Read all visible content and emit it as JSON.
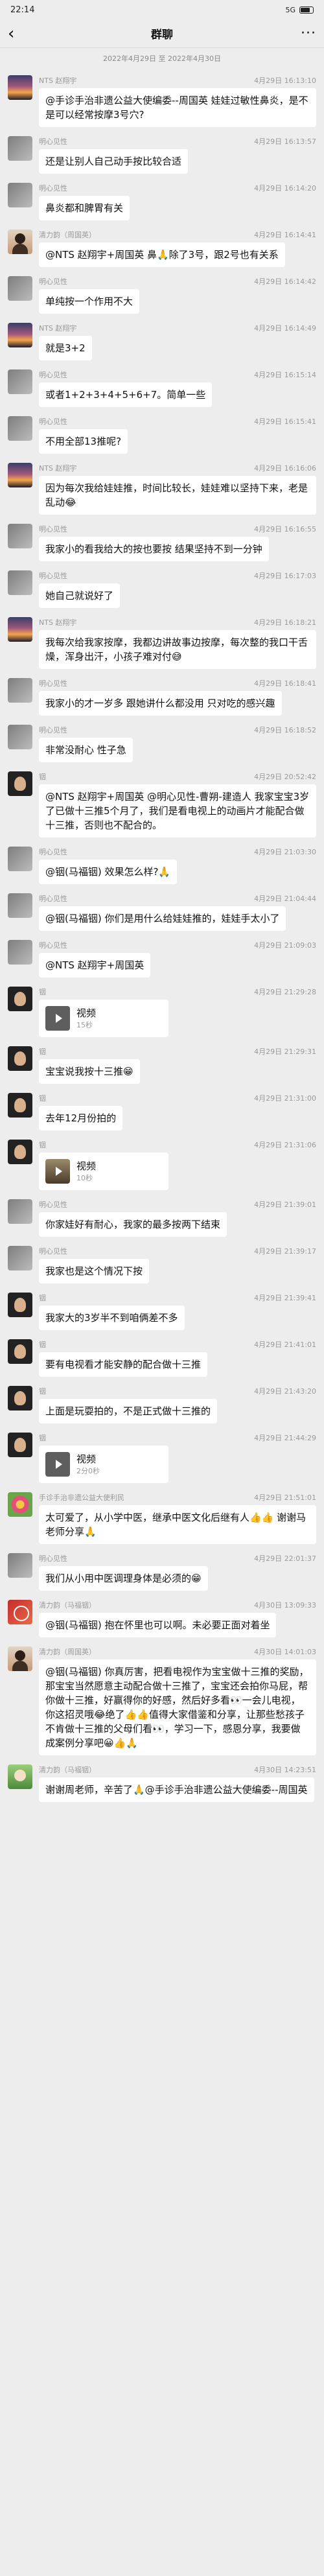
{
  "status": {
    "time": "22:14",
    "signal": "5G"
  },
  "nav": {
    "back": "‹",
    "title": "群聊",
    "more": "···"
  },
  "date_range": "2022年4月29日 至 2022年4月30日",
  "messages": [
    {
      "name": "NTS 赵翔宇",
      "time": "4月29日 16:13:10",
      "text": "@手诊手治非遗公益大使编委--周国英 娃娃过敏性鼻炎，是不是可以经常按摩3号穴?",
      "avatar": "sunset"
    },
    {
      "name": "明心见性",
      "time": "4月29日 16:13:57",
      "text": "还是让别人自己动手按比较合适",
      "avatar": "grey"
    },
    {
      "name": "明心见性",
      "time": "4月29日 16:14:20",
      "text": "鼻炎都和脾胃有关",
      "avatar": "grey"
    },
    {
      "name": "清力韵（周国英）",
      "time": "4月29日 16:14:41",
      "text": "@NTS 赵翔宇+周国英 鼻🙏除了3号，跟2号也有关系",
      "avatar": "person"
    },
    {
      "name": "明心见性",
      "time": "4月29日 16:14:42",
      "text": "单纯按一个作用不大",
      "avatar": "grey"
    },
    {
      "name": "NTS 赵翔宇",
      "time": "4月29日 16:14:49",
      "text": "就是3+2",
      "avatar": "sunset"
    },
    {
      "name": "明心见性",
      "time": "4月29日 16:15:14",
      "text": "或者1+2+3+4+5+6+7。简单一些",
      "avatar": "grey"
    },
    {
      "name": "明心见性",
      "time": "4月29日 16:15:41",
      "text": "不用全部13推呢?",
      "avatar": "grey"
    },
    {
      "name": "NTS 赵翔宇",
      "time": "4月29日 16:16:06",
      "text": "因为每次我给娃娃推，时间比较长，娃娃难以坚持下来，老是乱动😂",
      "avatar": "sunset"
    },
    {
      "name": "明心见性",
      "time": "4月29日 16:16:55",
      "text": "我家小的看我给大的按也要按 结果坚持不到一分钟",
      "avatar": "grey"
    },
    {
      "name": "明心见性",
      "time": "4月29日 16:17:03",
      "text": "她自己就说好了",
      "avatar": "grey"
    },
    {
      "name": "NTS 赵翔宇",
      "time": "4月29日 16:18:21",
      "text": "我每次给我家按摩，我都边讲故事边按摩，每次整的我口干舌燥，浑身出汗，小孩子难对付😅",
      "avatar": "sunset"
    },
    {
      "name": "明心见性",
      "time": "4月29日 16:18:41",
      "text": "我家小的才一岁多 跟她讲什么都没用 只对吃的感兴趣",
      "avatar": "grey"
    },
    {
      "name": "明心见性",
      "time": "4月29日 16:18:52",
      "text": "非常没耐心 性子急",
      "avatar": "grey"
    },
    {
      "name": "铟",
      "time": "4月29日 20:52:42",
      "text": "@NTS 赵翔宇+周国英 @明心见性-曹朔-建造人 我家宝宝3岁了已做十三推5个月了，我们是看电视上的动画片才能配合做十三推，否则也不配合的。",
      "avatar": "dark"
    },
    {
      "name": "明心见性",
      "time": "4月29日 21:03:30",
      "text": "@铟(马福铟) 效果怎么样?🙏",
      "avatar": "grey"
    },
    {
      "name": "明心见性",
      "time": "4月29日 21:04:44",
      "text": "@铟(马福铟) 你们是用什么给娃娃推的，娃娃手太小了",
      "avatar": "grey"
    },
    {
      "name": "明心见性",
      "time": "4月29日 21:09:03",
      "text": "@NTS 赵翔宇+周国英",
      "avatar": "grey"
    },
    {
      "name": "铟",
      "time": "4月29日 21:29:28",
      "video": {
        "title": "视频",
        "duration": "15秒"
      },
      "avatar": "dark"
    },
    {
      "name": "铟",
      "time": "4月29日 21:29:31",
      "text": "宝宝说我按十三推😁",
      "avatar": "dark"
    },
    {
      "name": "铟",
      "time": "4月29日 21:31:00",
      "text": "去年12月份拍的",
      "avatar": "dark"
    },
    {
      "name": "铟",
      "time": "4月29日 21:31:06",
      "video": {
        "title": "视频",
        "duration": "10秒"
      },
      "avatar": "dark",
      "photo": true
    },
    {
      "name": "明心见性",
      "time": "4月29日 21:39:01",
      "text": "你家娃好有耐心，我家的最多按两下结束",
      "avatar": "grey"
    },
    {
      "name": "明心见性",
      "time": "4月29日 21:39:17",
      "text": "我家也是这个情况下按",
      "avatar": "grey"
    },
    {
      "name": "铟",
      "time": "4月29日 21:39:41",
      "text": "我家大的3岁半不到咱俩差不多",
      "avatar": "dark"
    },
    {
      "name": "铟",
      "time": "4月29日 21:41:01",
      "text": "要有电视看才能安静的配合做十三推",
      "avatar": "dark"
    },
    {
      "name": "铟",
      "time": "4月29日 21:43:20",
      "text": "上面是玩耍拍的，不是正式做十三推的",
      "avatar": "dark"
    },
    {
      "name": "铟",
      "time": "4月29日 21:44:29",
      "video": {
        "title": "视频",
        "duration": "2分0秒"
      },
      "avatar": "dark"
    },
    {
      "name": "手诊手治非遗公益大使利民",
      "time": "4月29日 21:51:01",
      "text": "太可爱了，从小学中医，继承中医文化后继有人👍👍 谢谢马老师分享🙏",
      "avatar": "flower"
    },
    {
      "name": "明心见性",
      "time": "4月29日 22:01:37",
      "text": "我们从小用中医调理身体是必须的😁",
      "avatar": "grey"
    },
    {
      "name": "清力韵（马福铟）",
      "time": "4月30日 13:09:33",
      "text": "@铟(马福铟) 抱在怀里也可以啊。未必要正面对着坐",
      "avatar": "red"
    },
    {
      "name": "清力韵（周国英）",
      "time": "4月30日 14:01:03",
      "text": "@铟(马福铟) 你真厉害，把看电视作为宝宝做十三推的奖励，那宝宝当然愿意主动配合做十三推了，宝宝还会拍你马屁，帮你做十三推，好赢得你的好感，然后好多看👀一会儿电视，你这招灵哦😂绝了👍👍值得大家借鉴和分享，让那些愁孩子不肯做十三推的父母们看👀，学习一下，感恩分享，我要做成案例分享吧😀👍🙏",
      "avatar": "person"
    },
    {
      "name": "清力韵（马福铟）",
      "time": "4月30日 14:23:51",
      "text": "谢谢周老师，辛苦了🙏@手诊手治非遗公益大使编委--周国英",
      "avatar": "green"
    }
  ]
}
